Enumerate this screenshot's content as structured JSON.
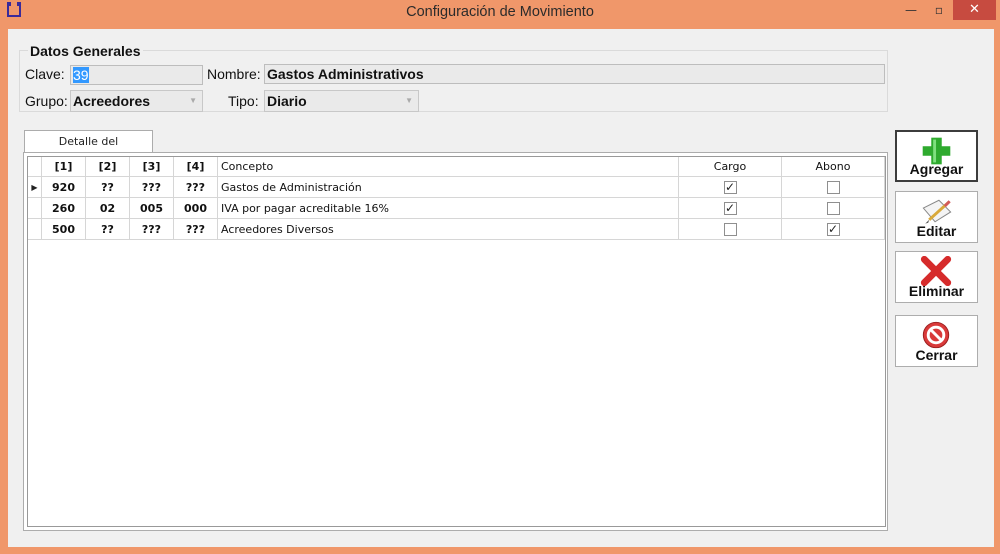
{
  "window": {
    "title": "Configuración de Movimiento",
    "min_glyph": "—",
    "max_glyph": "▫",
    "close_glyph": "✕"
  },
  "general": {
    "legend": "Datos Generales",
    "clave_label": "Clave:",
    "clave_value": "39",
    "nombre_label": "Nombre:",
    "nombre_value": "Gastos Administrativos",
    "grupo_label": "Grupo:",
    "grupo_value": "Acreedores",
    "tipo_label": "Tipo:",
    "tipo_value": "Diario"
  },
  "tab": {
    "label": "Detalle del movimiento"
  },
  "grid": {
    "headers": [
      "[1]",
      "[2]",
      "[3]",
      "[4]",
      "Concepto",
      "Cargo",
      "Abono"
    ],
    "rows": [
      {
        "c1": "920",
        "c2": "??",
        "c3": "???",
        "c4": "???",
        "concepto": "Gastos de Administración",
        "cargo": true,
        "abono": false
      },
      {
        "c1": "260",
        "c2": "02",
        "c3": "005",
        "c4": "000",
        "concepto": "IVA por pagar acreditable 16%",
        "cargo": true,
        "abono": false
      },
      {
        "c1": "500",
        "c2": "??",
        "c3": "???",
        "c4": "???",
        "concepto": "Acreedores Diversos",
        "cargo": false,
        "abono": true
      }
    ]
  },
  "buttons": {
    "agregar": "Agregar",
    "editar": "Editar",
    "eliminar": "Eliminar",
    "cerrar": "Cerrar"
  },
  "colors": {
    "window_frame": "#F0976A",
    "close_button": "#C74B40",
    "selection": "#3399FF"
  }
}
